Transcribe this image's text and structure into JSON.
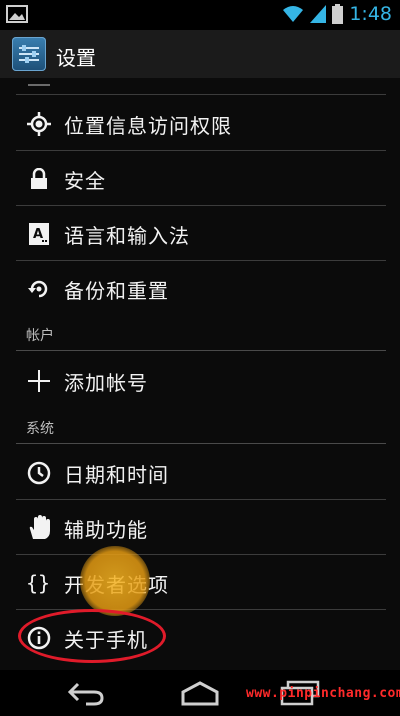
{
  "status_bar": {
    "time": "1:48"
  },
  "action_bar": {
    "title": "设置"
  },
  "sections": {
    "accounts": "帐户",
    "system": "系统"
  },
  "items": [
    {
      "label": "位置信息访问权限",
      "icon": "location-icon"
    },
    {
      "label": "安全",
      "icon": "lock-icon"
    },
    {
      "label": "语言和输入法",
      "icon": "keyboard-language-icon"
    },
    {
      "label": "备份和重置",
      "icon": "backup-restore-icon"
    },
    {
      "label": "添加帐号",
      "icon": "plus-icon"
    },
    {
      "label": "日期和时间",
      "icon": "clock-icon"
    },
    {
      "label": "辅助功能",
      "icon": "hand-icon"
    },
    {
      "label": "开发者选项",
      "icon": "braces-icon"
    },
    {
      "label": "关于手机",
      "icon": "info-icon"
    }
  ],
  "colors": {
    "accent": "#35b5e5",
    "highlight": "#e01b2a",
    "touch": "#f5b321"
  },
  "watermark": "www.pinpinchang.com"
}
